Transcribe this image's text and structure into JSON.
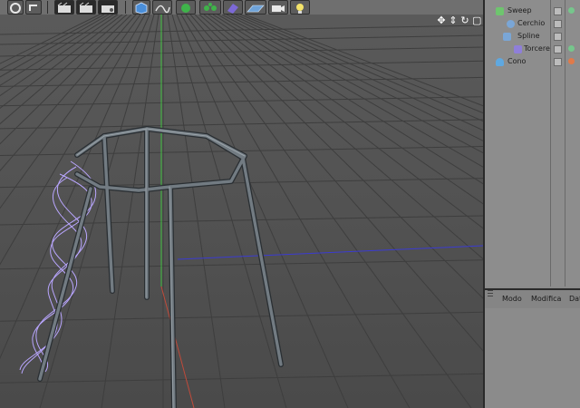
{
  "toolbar": {
    "buttons": [
      "render-region-button",
      "render-view-button",
      "render-settings-button",
      "cube-button",
      "spline-pen-button",
      "nurbs-button",
      "array-button",
      "deformer-button",
      "floor-button",
      "camera-button",
      "light-button"
    ]
  },
  "viewport": {
    "nav_icons": {
      "move": "✥",
      "scale": "⇕",
      "rotate": "↻",
      "maximize": "▢"
    }
  },
  "object_manager": {
    "objects": [
      {
        "label": "Sweep",
        "icon": "sweep-nurbs-icon",
        "color": "#6ec56e",
        "indent": 0
      },
      {
        "label": "Cerchio",
        "icon": "circle-spline-icon",
        "color": "#7aa6d6",
        "indent": 1
      },
      {
        "label": "Spline",
        "icon": "spline-icon",
        "color": "#7aa6d6",
        "indent": 1
      },
      {
        "label": "Torcere",
        "icon": "twist-deformer-icon",
        "color": "#8f7fd9",
        "indent": 2
      },
      {
        "label": "Cono",
        "icon": "cone-icon",
        "color": "#5fa8e0",
        "indent": 0
      }
    ]
  },
  "attribute_manager": {
    "tabs": [
      "Modo",
      "Modifica",
      "Dat"
    ]
  },
  "colors": {
    "y_axis": "#3fbf3f",
    "x_axis": "#3b3bd0",
    "z_axis": "#c04a3a",
    "selection": "#b9a6ff"
  }
}
